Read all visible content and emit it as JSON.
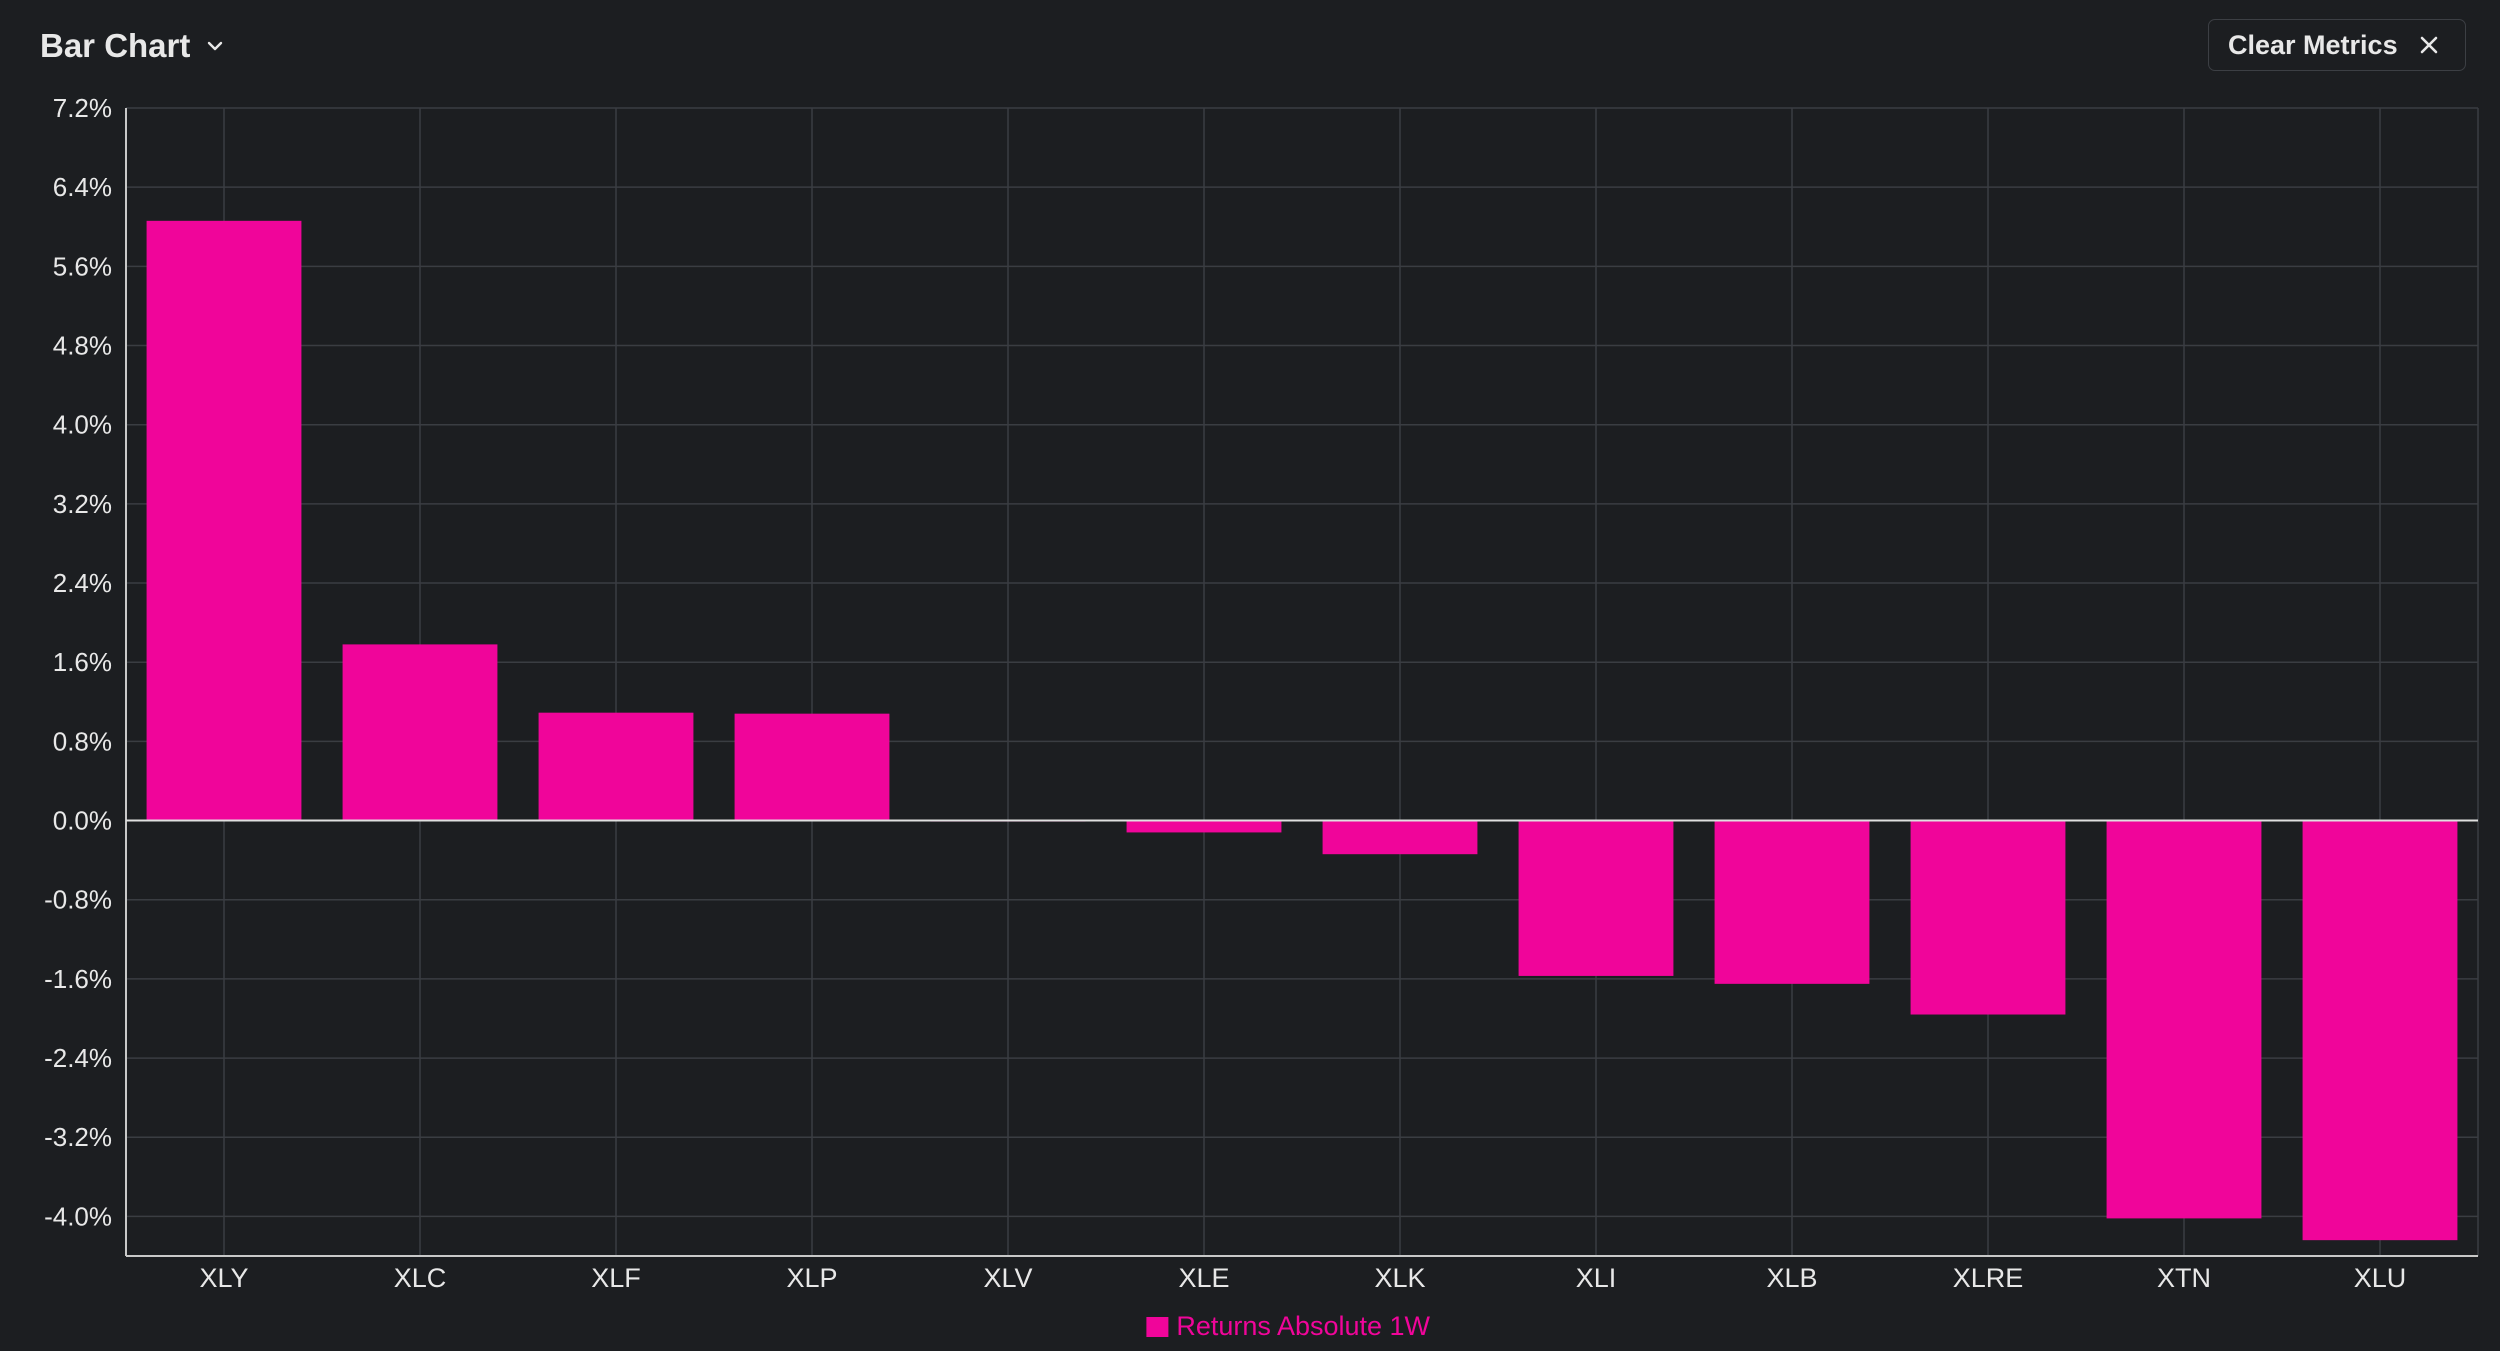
{
  "header": {
    "chart_type_label": "Bar Chart",
    "chart_type_icon": "chevron-down-icon",
    "clear_label": "Clear Metrics",
    "clear_icon": "close-icon"
  },
  "colors": {
    "background": "#1c1e21",
    "bar": "#f0059a",
    "grid": "#3a3d42",
    "axis": "#c8c8c8",
    "text": "#e8e8e8"
  },
  "chart_data": {
    "type": "bar",
    "categories": [
      "XLY",
      "XLC",
      "XLF",
      "XLP",
      "XLV",
      "XLE",
      "XLK",
      "XLI",
      "XLB",
      "XLRE",
      "XTN",
      "XLU"
    ],
    "series": [
      {
        "name": "Returns Absolute 1W",
        "color": "#f0059a",
        "values": [
          6.06,
          1.78,
          1.09,
          1.08,
          0.01,
          -0.12,
          -0.34,
          -1.57,
          -1.65,
          -1.96,
          -4.02,
          -4.24
        ]
      }
    ],
    "yticks": [
      "7.2%",
      "6.4%",
      "5.6%",
      "4.8%",
      "4.0%",
      "3.2%",
      "2.4%",
      "1.6%",
      "0.8%",
      "0.0%",
      "-0.8%",
      "-1.6%",
      "-2.4%",
      "-3.2%",
      "-4.0%"
    ],
    "ytick_values": [
      7.2,
      6.4,
      5.6,
      4.8,
      4.0,
      3.2,
      2.4,
      1.6,
      0.8,
      0.0,
      -0.8,
      -1.6,
      -2.4,
      -3.2,
      -4.0
    ],
    "ylim": [
      -4.4,
      7.2
    ],
    "yunit": "%",
    "grid": true,
    "legend_position": "bottom-center"
  }
}
